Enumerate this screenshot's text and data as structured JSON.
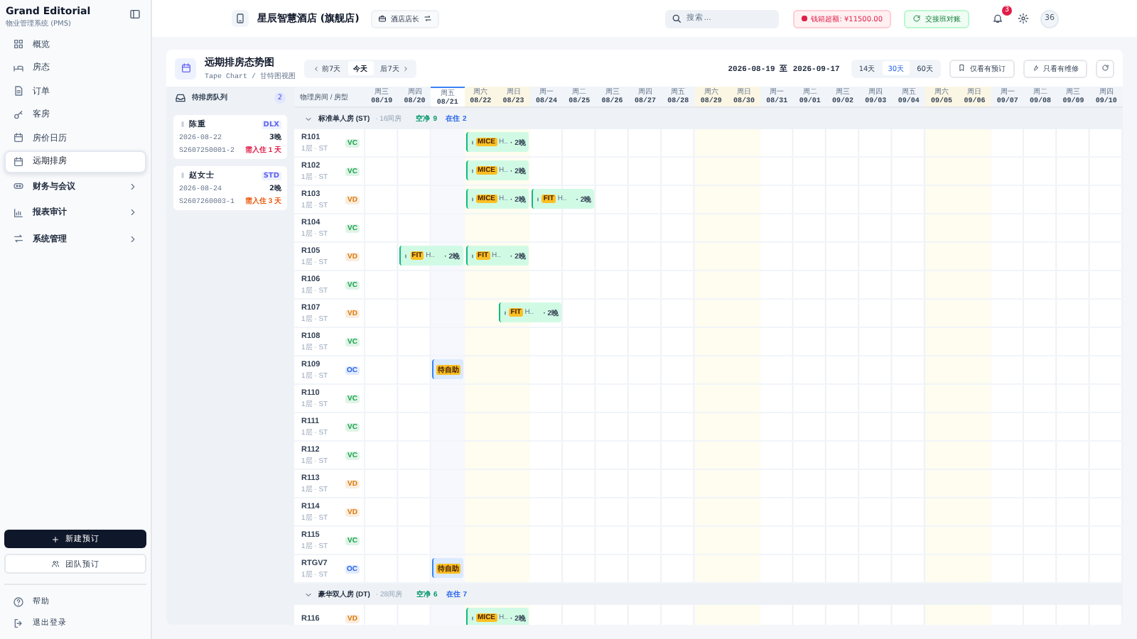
{
  "sidebar": {
    "brand": "Grand Editorial",
    "subtitle": "物业管理系统 (PMS)",
    "items": [
      {
        "label": "概览",
        "selected": false
      },
      {
        "label": "房态",
        "selected": false
      },
      {
        "label": "订单",
        "selected": false
      },
      {
        "label": "客房",
        "selected": false
      },
      {
        "label": "房价日历",
        "selected": false
      },
      {
        "label": "远期排房",
        "selected": true
      }
    ],
    "groups": [
      {
        "label": "财务与会议",
        "expanded": false
      },
      {
        "label": "报表审计",
        "expanded": false
      },
      {
        "label": "系统管理",
        "expanded": false
      }
    ],
    "primary_button": "新建预订",
    "secondary_button": "团队预订",
    "footer": [
      {
        "label": "帮助"
      },
      {
        "label": "退出登录"
      }
    ]
  },
  "topbar": {
    "hotel": "星辰智慧酒店 (旗舰店)",
    "role": "酒店店长",
    "search": {
      "placeholder": "搜索..."
    },
    "alert": "钱箱超额: ¥11500.00",
    "handover": "交接班对账",
    "notifications": "3",
    "avatar": "36"
  },
  "page": {
    "title": "远期排房态势图",
    "subtitle": "Tape Chart / 甘特图视图",
    "nav": [
      {
        "label": "前7天",
        "selected": false
      },
      {
        "label": "今天",
        "selected": true
      },
      {
        "label": "后7天",
        "selected": false
      }
    ],
    "range": "2026-08-19 至 2026-09-17",
    "spans": [
      {
        "label": "14天",
        "selected": false
      },
      {
        "label": "30天",
        "selected": true
      },
      {
        "label": "60天",
        "selected": false
      }
    ],
    "filters": [
      {
        "label": "仅看有预订"
      },
      {
        "label": "只看有维修"
      }
    ]
  },
  "queue": {
    "title": "待排房队列",
    "count": "2",
    "cards": [
      {
        "name": "陈重",
        "tag": "DLX",
        "date": "2026-08-22",
        "nights": "3晚",
        "ref": "S2607250001-2",
        "due": "需入住 1 天",
        "color": "#e11d48"
      },
      {
        "name": "赵女士",
        "tag": "STD",
        "date": "2026-08-24",
        "nights": "2晚",
        "ref": "S2607260003-1",
        "due": "需入住 3 天",
        "color": "#ea580c"
      }
    ]
  },
  "chart": {
    "room_header": "物理房间 / 房型",
    "days": [
      {
        "dow": "周三",
        "date": "08/19",
        "weekend": false,
        "today": false
      },
      {
        "dow": "周四",
        "date": "08/20",
        "weekend": false,
        "today": false
      },
      {
        "dow": "周五",
        "date": "08/21",
        "weekend": false,
        "today": true
      },
      {
        "dow": "周六",
        "date": "08/22",
        "weekend": true,
        "today": false
      },
      {
        "dow": "周日",
        "date": "08/23",
        "weekend": true,
        "today": false
      },
      {
        "dow": "周一",
        "date": "08/24",
        "weekend": false,
        "today": false
      },
      {
        "dow": "周二",
        "date": "08/25",
        "weekend": false,
        "today": false
      },
      {
        "dow": "周三",
        "date": "08/26",
        "weekend": false,
        "today": false
      },
      {
        "dow": "周四",
        "date": "08/27",
        "weekend": false,
        "today": false
      },
      {
        "dow": "周五",
        "date": "08/28",
        "weekend": false,
        "today": false
      },
      {
        "dow": "周六",
        "date": "08/29",
        "weekend": true,
        "today": false
      },
      {
        "dow": "周日",
        "date": "08/30",
        "weekend": true,
        "today": false
      },
      {
        "dow": "周一",
        "date": "08/31",
        "weekend": false,
        "today": false
      },
      {
        "dow": "周二",
        "date": "09/01",
        "weekend": false,
        "today": false
      },
      {
        "dow": "周三",
        "date": "09/02",
        "weekend": false,
        "today": false
      },
      {
        "dow": "周四",
        "date": "09/03",
        "weekend": false,
        "today": false
      },
      {
        "dow": "周五",
        "date": "09/04",
        "weekend": false,
        "today": false
      },
      {
        "dow": "周六",
        "date": "09/05",
        "weekend": true,
        "today": false
      },
      {
        "dow": "周日",
        "date": "09/06",
        "weekend": true,
        "today": false
      },
      {
        "dow": "周一",
        "date": "09/07",
        "weekend": false,
        "today": false
      },
      {
        "dow": "周二",
        "date": "09/08",
        "weekend": false,
        "today": false
      },
      {
        "dow": "周三",
        "date": "09/09",
        "weekend": false,
        "today": false
      },
      {
        "dow": "周四",
        "date": "09/10",
        "weekend": false,
        "today": false
      }
    ],
    "groups": [
      {
        "name": "标准单人房 (ST)",
        "count": "· 16间房",
        "vacant_label": "空净",
        "vacant": "9",
        "occupied_label": "在住",
        "occupied": "2",
        "expanded": true,
        "rooms": [
          {
            "number": "R101",
            "sub": "1层 · ST",
            "status": "VC",
            "color": "#16a34a",
            "timeline": [
              {
                "kind": "free"
              },
              {
                "kind": "free"
              },
              {
                "kind": "free"
              },
              {
                "kind": "confirmed",
                "tag": "MICE",
                "guest": "H..",
                "nights": "· 2晚"
              }
            ]
          },
          {
            "number": "R102",
            "sub": "1层 · ST",
            "status": "VC",
            "color": "#16a34a",
            "timeline": [
              {
                "kind": "free"
              },
              {
                "kind": "free"
              },
              {
                "kind": "free"
              },
              {
                "kind": "confirmed",
                "tag": "MICE",
                "guest": "H..",
                "nights": "· 2晚"
              }
            ]
          },
          {
            "number": "R103",
            "sub": "1层 · ST",
            "status": "VD",
            "color": "#d97706",
            "timeline": [
              {
                "kind": "free"
              },
              {
                "kind": "free"
              },
              {
                "kind": "free"
              },
              {
                "kind": "confirmed",
                "tag": "MICE",
                "guest": "H..",
                "nights": "· 2晚"
              },
              {
                "kind": "confirmed",
                "tag": "FIT",
                "guest": "H..",
                "nights": "· 2晚"
              }
            ]
          },
          {
            "number": "R104",
            "sub": "1层 · ST",
            "status": "VC",
            "color": "#16a34a"
          },
          {
            "number": "R105",
            "sub": "1层 · ST",
            "status": "VD",
            "color": "#d97706",
            "timeline": [
              {
                "kind": "free"
              },
              {
                "kind": "confirmed",
                "tag": "FIT",
                "guest": "H..",
                "nights": "· 2晚"
              },
              {
                "kind": "confirmed",
                "tag": "FIT",
                "guest": "H..",
                "nights": "· 2晚"
              }
            ]
          },
          {
            "number": "R106",
            "sub": "1层 · ST",
            "status": "VC",
            "color": "#16a34a"
          },
          {
            "number": "R107",
            "sub": "1层 · ST",
            "status": "VD",
            "color": "#d97706",
            "timeline": [
              {
                "kind": "free"
              },
              {
                "kind": "free"
              },
              {
                "kind": "free"
              },
              {
                "kind": "free"
              },
              {
                "kind": "confirmed",
                "tag": "FIT",
                "guest": "H..",
                "nights": "· 2晚"
              }
            ]
          },
          {
            "number": "R108",
            "sub": "1层 · ST",
            "status": "VC",
            "color": "#16a34a"
          },
          {
            "number": "R109",
            "sub": "1层 · ST",
            "status": "OC",
            "color": "#2563eb",
            "timeline": [
              {
                "kind": "free"
              },
              {
                "kind": "free"
              },
              {
                "kind": "pending",
                "tag": "待自助"
              }
            ]
          },
          {
            "number": "R110",
            "sub": "1层 · ST",
            "status": "VC",
            "color": "#16a34a"
          },
          {
            "number": "R111",
            "sub": "1层 · ST",
            "status": "VC",
            "color": "#16a34a"
          },
          {
            "number": "R112",
            "sub": "1层 · ST",
            "status": "VC",
            "color": "#16a34a"
          },
          {
            "number": "R113",
            "sub": "1层 · ST",
            "status": "VD",
            "color": "#d97706"
          },
          {
            "number": "R114",
            "sub": "1层 · ST",
            "status": "VD",
            "color": "#d97706"
          },
          {
            "number": "R115",
            "sub": "1层 · ST",
            "status": "VC",
            "color": "#16a34a"
          },
          {
            "number": "RTGV7",
            "sub": "1层 · ST",
            "status": "OC",
            "color": "#2563eb",
            "timeline": [
              {
                "kind": "free"
              },
              {
                "kind": "free"
              },
              {
                "kind": "pending",
                "tag": "待自助"
              }
            ]
          }
        ]
      },
      {
        "name": "豪华双人房 (DT)",
        "count": "· 28间房",
        "vacant_label": "空净",
        "vacant": "6",
        "occupied_label": "在住",
        "occupied": "7",
        "expanded": true,
        "rooms": [
          {
            "number": "R116",
            "status": "VD",
            "color": "#d97706",
            "timeline": [
              {
                "kind": "free"
              },
              {
                "kind": "free"
              },
              {
                "kind": "free"
              },
              {
                "kind": "confirmed",
                "tag": "MICE",
                "guest": "H..",
                "nights": "· 2晚"
              }
            ]
          }
        ]
      }
    ]
  }
}
